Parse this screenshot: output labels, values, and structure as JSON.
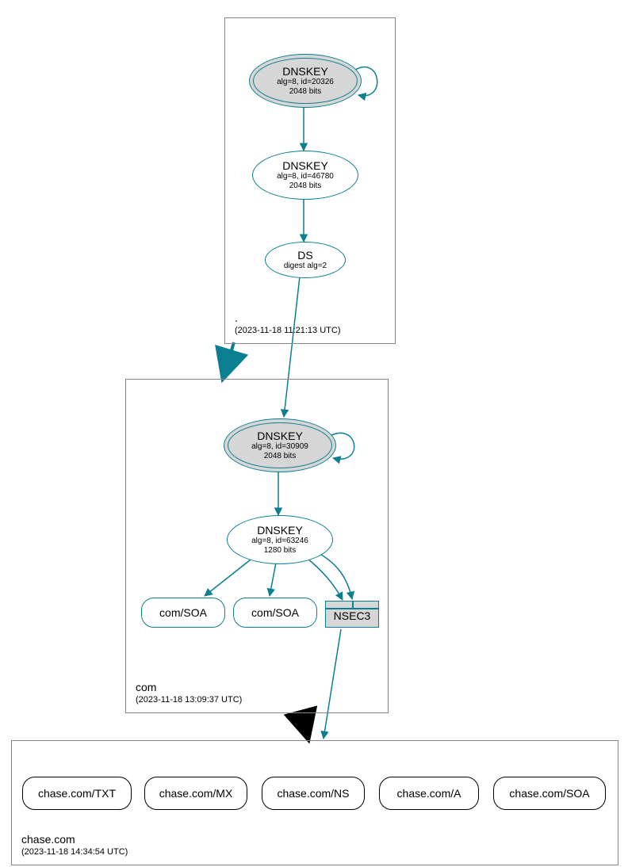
{
  "colors": {
    "teal": "#0a7f8f"
  },
  "zones": {
    "root": {
      "name": ".",
      "ts": "(2023-11-18 11:21:13 UTC)"
    },
    "com": {
      "name": "com",
      "ts": "(2023-11-18 13:09:37 UTC)"
    },
    "chase": {
      "name": "chase.com",
      "ts": "(2023-11-18 14:34:54 UTC)"
    }
  },
  "nodes": {
    "root_ksk": {
      "title": "DNSKEY",
      "alg": "alg=8, id=20326",
      "bits": "2048 bits"
    },
    "root_zsk": {
      "title": "DNSKEY",
      "alg": "alg=8, id=46780",
      "bits": "2048 bits"
    },
    "root_ds": {
      "title": "DS",
      "alg": "digest alg=2"
    },
    "com_ksk": {
      "title": "DNSKEY",
      "alg": "alg=8, id=30909",
      "bits": "2048 bits"
    },
    "com_zsk": {
      "title": "DNSKEY",
      "alg": "alg=8, id=63246",
      "bits": "1280 bits"
    },
    "com_soa1": {
      "label": "com/SOA"
    },
    "com_soa2": {
      "label": "com/SOA"
    },
    "nsec3": {
      "label": "NSEC3"
    },
    "chase_txt": {
      "label": "chase.com/TXT"
    },
    "chase_mx": {
      "label": "chase.com/MX"
    },
    "chase_ns": {
      "label": "chase.com/NS"
    },
    "chase_a": {
      "label": "chase.com/A"
    },
    "chase_soa": {
      "label": "chase.com/SOA"
    }
  }
}
